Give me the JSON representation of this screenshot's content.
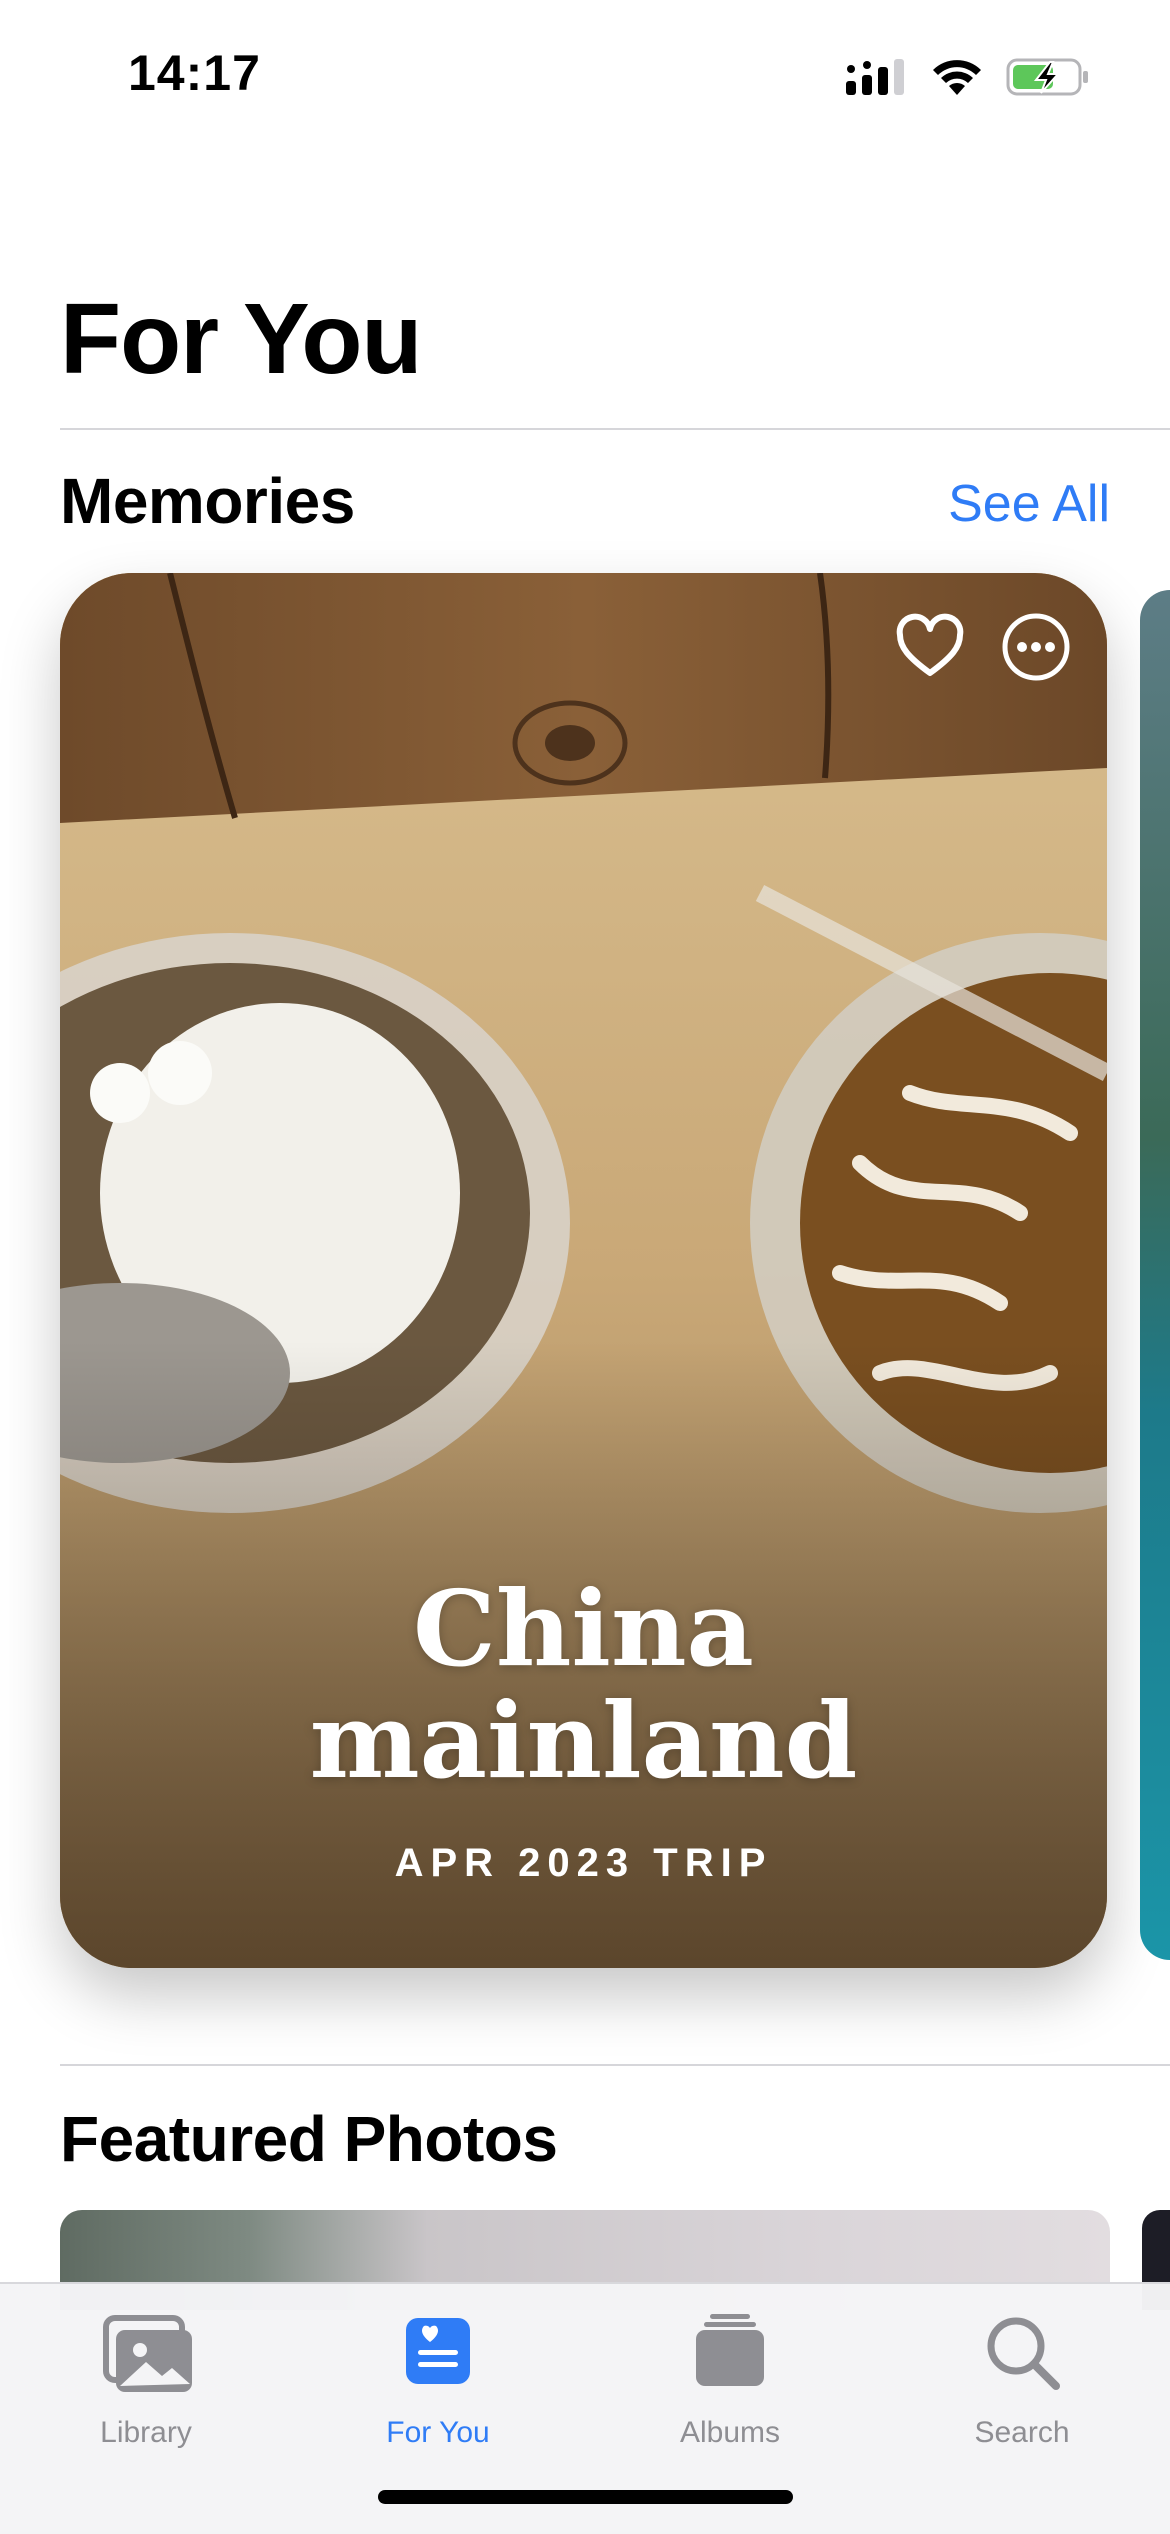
{
  "status_bar": {
    "time": "14:17",
    "icons": [
      "cellular-signal-icon",
      "wifi-icon",
      "battery-charging-icon"
    ],
    "battery_color": "#5dc75a"
  },
  "header": {
    "title": "For You"
  },
  "memories": {
    "section_title": "Memories",
    "see_all_label": "See All",
    "card": {
      "title_line1": "China",
      "title_line2": "mainland",
      "subtitle": "APR 2023 TRIP",
      "icons": [
        "heart-icon",
        "more-options-icon"
      ]
    }
  },
  "featured": {
    "section_title": "Featured Photos"
  },
  "tab_bar": {
    "tabs": [
      {
        "label": "Library",
        "icon": "library-photos-icon",
        "active": false
      },
      {
        "label": "For You",
        "icon": "for-you-icon",
        "active": true
      },
      {
        "label": "Albums",
        "icon": "albums-stack-icon",
        "active": false
      },
      {
        "label": "Search",
        "icon": "search-icon",
        "active": false
      }
    ],
    "accent_color": "#2f7cf6",
    "inactive_color": "#8e8e93"
  }
}
